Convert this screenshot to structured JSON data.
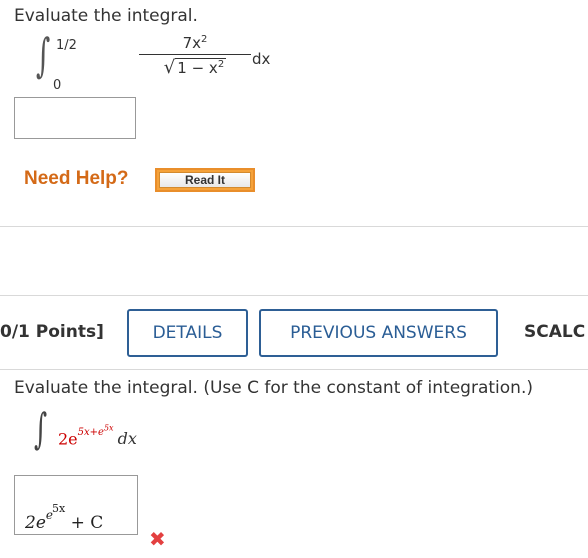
{
  "question1": {
    "prompt": "Evaluate the integral.",
    "upper": "1/2",
    "lower": "0",
    "numerator": "7x",
    "num_exp": "2",
    "den_prefix": "1 − x",
    "den_exp": "2",
    "dx": "dx",
    "answer_value": ""
  },
  "help": {
    "need_help": "Need Help?",
    "read_it": "Read It"
  },
  "question2_header": {
    "points": "0/1 Points]",
    "details": "DETAILS",
    "previous_answers": "PREVIOUS ANSWERS",
    "scalc": "SCALC"
  },
  "question2": {
    "prompt": "Evaluate the integral. (Use C for the constant of integration.)",
    "coef": "2e",
    "exponent": "5x+e",
    "exponent_exp": "5x",
    "dx": "dx",
    "answer": {
      "coef": "2e",
      "exp1": "e",
      "exp2": "5x",
      "tail": "+ C"
    },
    "status_icon": "wrong-x-icon",
    "status_color": "#e34040"
  }
}
